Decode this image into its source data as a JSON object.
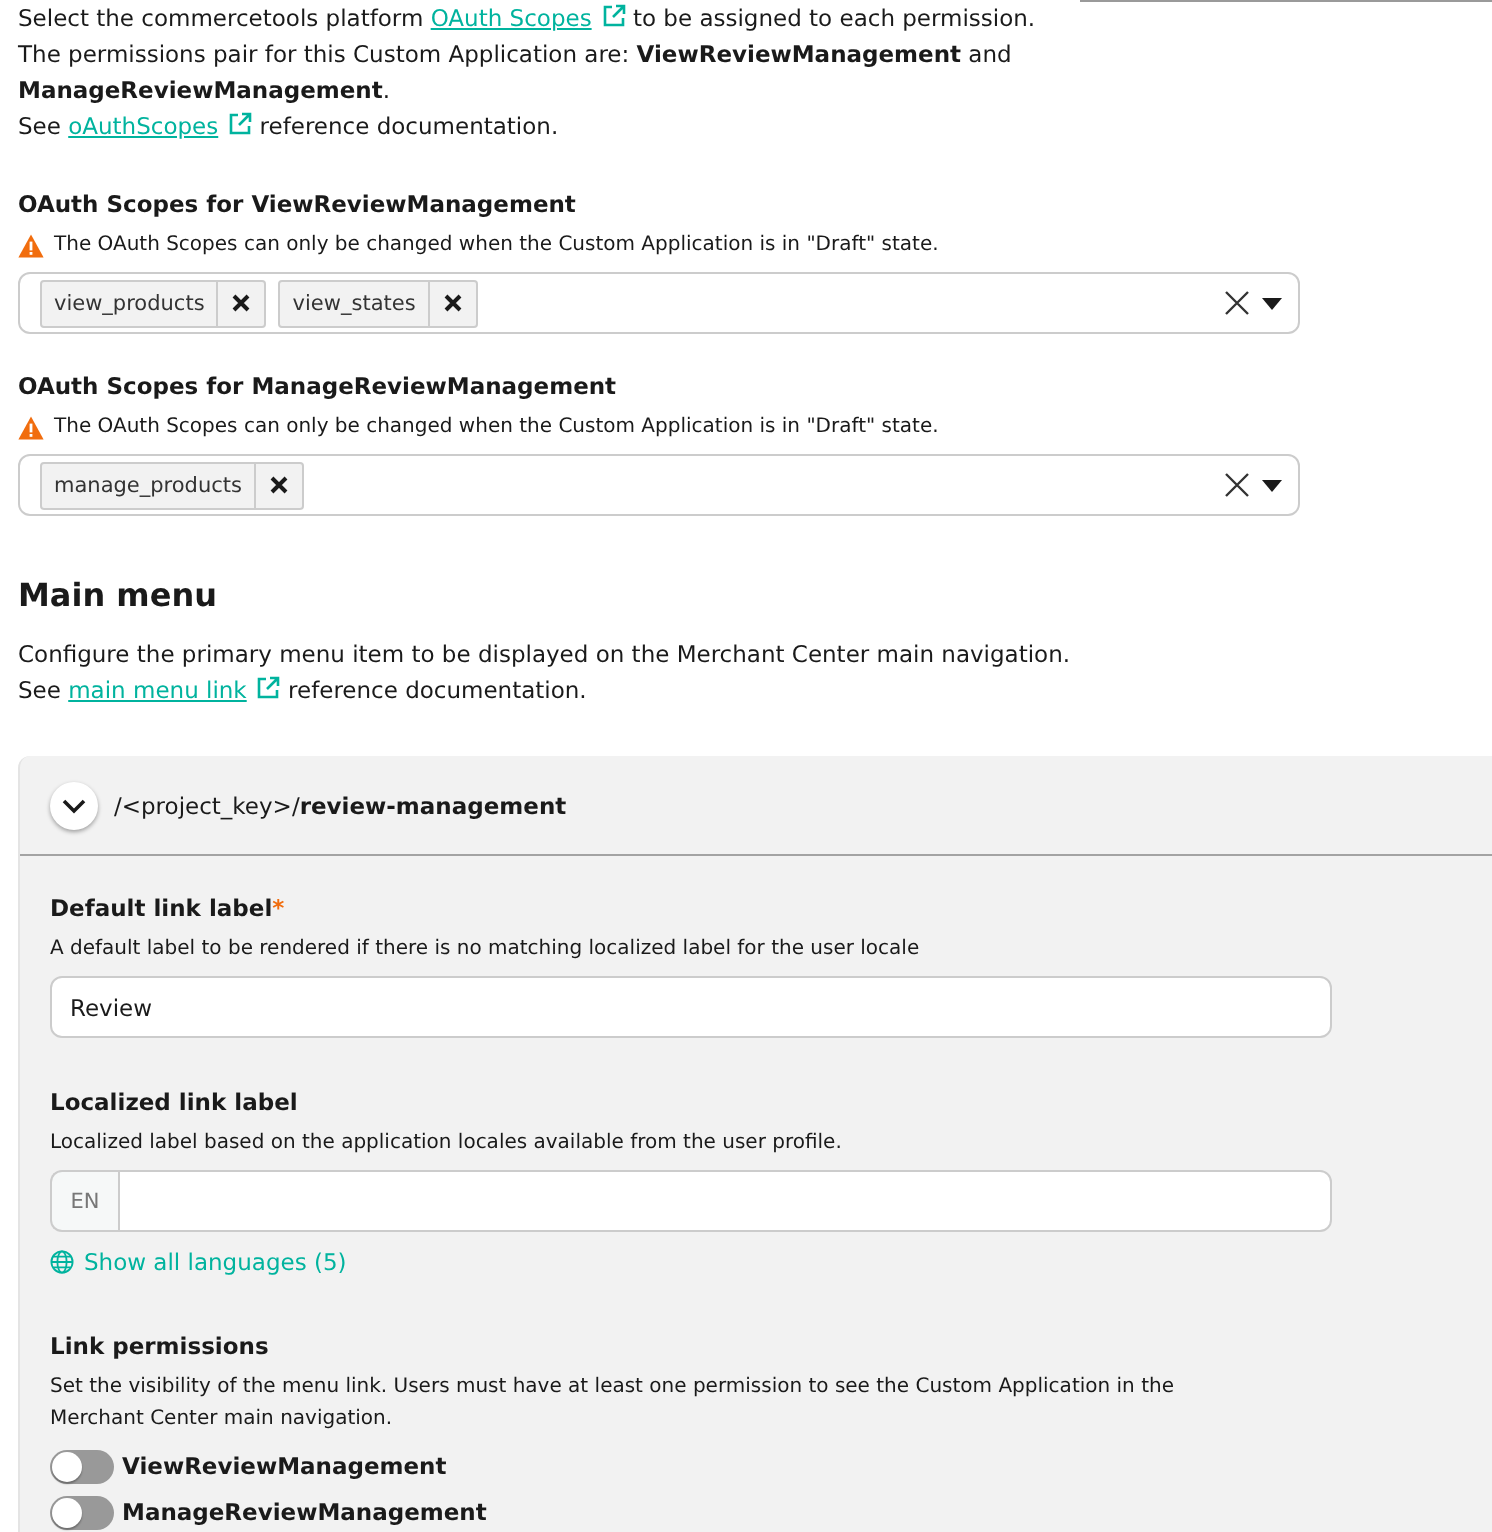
{
  "intro": [
    {
      "kind": "link_line",
      "before": "Select the commercetools platform",
      "link": "OAuth Scopes",
      "after": "to be assigned to each permission."
    },
    {
      "kind": "text",
      "text": "The permissions pair for this Custom Application are: **ViewReviewManagement** and **ManageReviewManagement**."
    },
    {
      "kind": "link_line",
      "before": "See",
      "link": "oAuthScopes",
      "after": "reference documentation."
    }
  ],
  "oauth_scopes": [
    {
      "title": "OAuth Scopes for ViewReviewManagement",
      "warning": "The OAuth Scopes can only be changed when the Custom Application is in \"Draft\" state.",
      "tags": [
        "view_products",
        "view_states"
      ]
    },
    {
      "title": "OAuth Scopes for ManageReviewManagement",
      "warning": "The OAuth Scopes can only be changed when the Custom Application is in \"Draft\" state.",
      "tags": [
        "manage_products"
      ]
    }
  ],
  "main_menu": {
    "title": "Main menu",
    "description": [
      {
        "kind": "text",
        "text": "Configure the primary menu item to be displayed on the Merchant Center main navigation."
      },
      {
        "kind": "link_line",
        "before": "See",
        "link": "main menu link",
        "after": "reference documentation."
      }
    ]
  },
  "menu_link": {
    "path": "/<project_key>/**review-management**",
    "expanded": true,
    "default_label": {
      "label": "Default link label",
      "required_mark": "*",
      "hint": "A default label to be rendered if there is no matching localized label for the user locale",
      "value": "Review"
    },
    "localized_label": {
      "label": "Localized link label",
      "hint": "Localized label based on the application locales available from the user profile.",
      "language": "EN",
      "show_all": "Show all languages (5)"
    },
    "permissions": {
      "label": "Link permissions",
      "hint": "Set the visibility of the menu link. Users must have at least one permission to see the Custom Application in the Merchant Center main navigation.",
      "toggles": [
        {
          "label": "ViewReviewManagement",
          "on": false
        },
        {
          "label": "ManageReviewManagement",
          "on": false
        }
      ]
    }
  }
}
